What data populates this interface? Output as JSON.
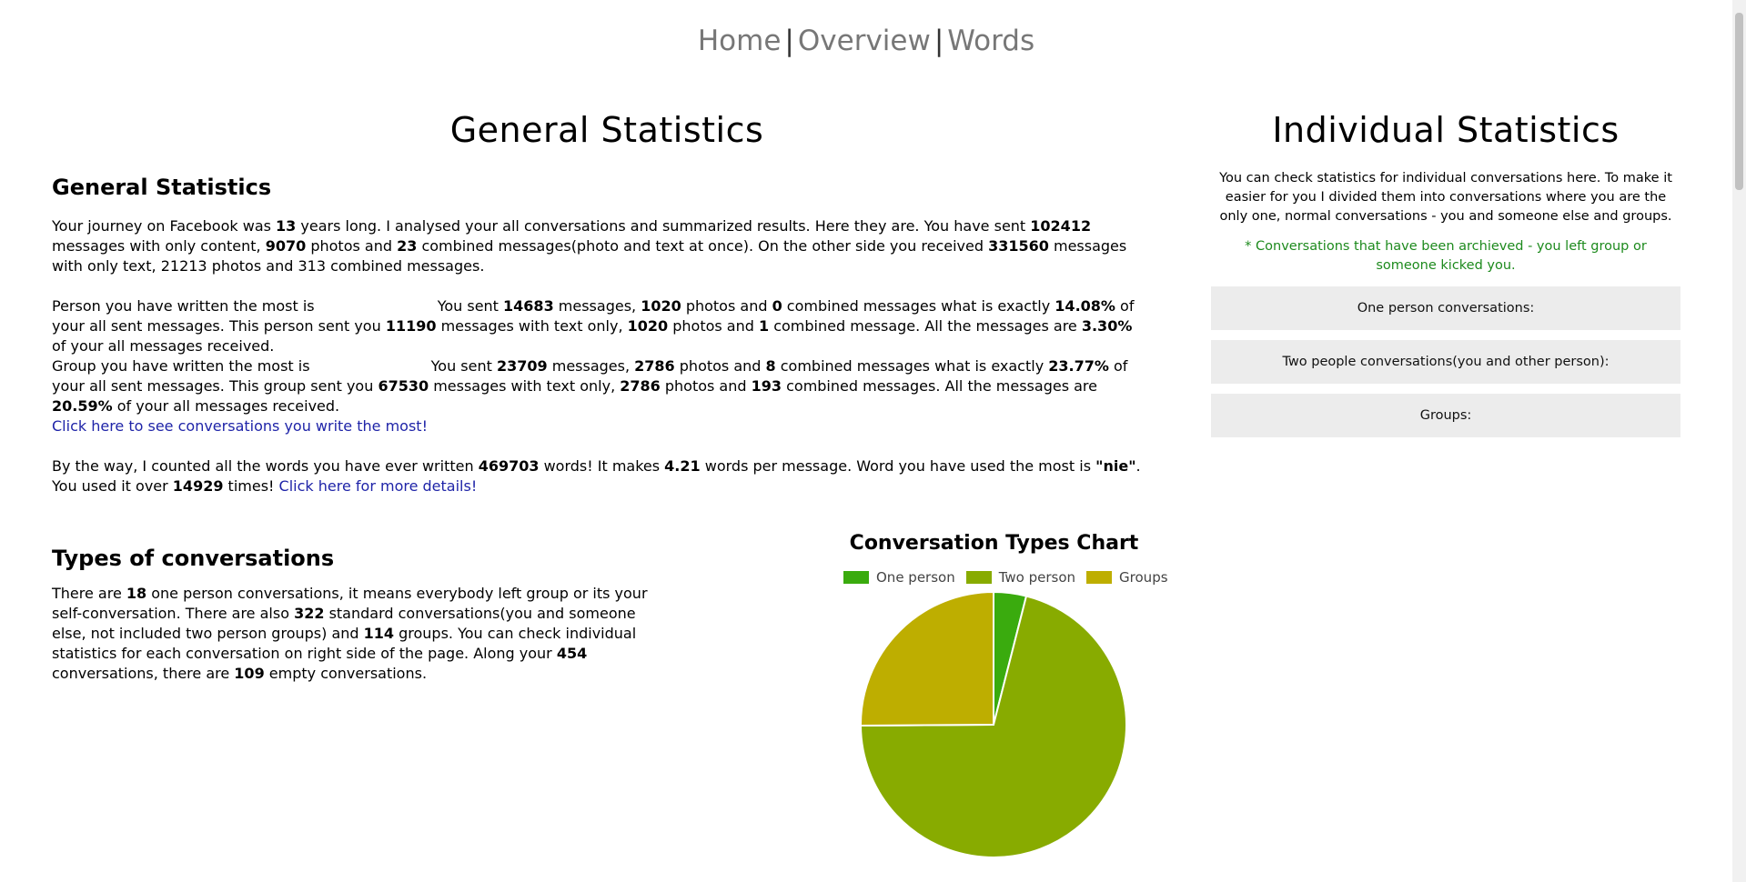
{
  "nav": {
    "home": "Home",
    "overview": "Overview",
    "words": "Words",
    "sep": "|"
  },
  "left": {
    "title": "General Statistics",
    "section1": {
      "heading": "General Statistics",
      "p1": [
        "Your journey on Facebook was ",
        "13",
        " years long. I analysed your all conversations and summarized results. Here they are. You have sent ",
        "102412",
        " messages with only content, ",
        "9070",
        " photos and ",
        "23",
        " combined messages(photo and text at once). On the other side you received ",
        "331560",
        " messages with only text, 21213 photos and 313 combined messages."
      ],
      "p2a": [
        "Person you have written the most is ",
        "You sent ",
        "14683",
        " messages, ",
        "1020",
        " photos and ",
        "0",
        " combined messages what is exactly ",
        "14.08%",
        " of your all sent messages. This person sent you ",
        "11190",
        " messages with text only, ",
        "1020",
        " photos and ",
        "1",
        " combined message. All the messages are ",
        "3.30%",
        " of your all messages received."
      ],
      "p2b": [
        "Group you have written the most is ",
        "You sent ",
        "23709",
        " messages, ",
        "2786",
        " photos and ",
        "8",
        " combined messages what is exactly ",
        "23.77%",
        " of your all sent messages. This group sent you ",
        "67530",
        " messages with text only, ",
        "2786",
        " photos and ",
        "193",
        " combined messages. All the messages are ",
        "20.59%",
        " of your all messages received."
      ],
      "link1": "Click here to see conversations you write the most!",
      "p3": [
        "By the way, I counted all the words you have ever written ",
        "469703",
        " words! It makes ",
        "4.21",
        " words per message. Word you have used the most is ",
        "\"nie\"",
        ". You used it over ",
        "14929",
        " times! "
      ],
      "link2": "Click here for more details!"
    },
    "section2": {
      "heading": "Types of conversations",
      "p": [
        "There are ",
        "18",
        " one person conversations, it means everybody left group or its your self-conversation. There are also ",
        "322",
        " standard conversations(you and someone else, not included two person groups) and ",
        "114",
        " groups. You can check individual statistics for each conversation on right side of the page. Along your ",
        "454",
        " conversations, there are ",
        "109",
        " empty conversations."
      ]
    }
  },
  "right": {
    "title": "Individual Statistics",
    "desc": "You can check statistics for individual conversations here. To make it easier for you I divided them into conversations where you are the only one, normal conversations - you and someone else and groups.",
    "note": "* Conversations that have been archieved - you left group or someone kicked you.",
    "accordions": [
      "One person conversations:",
      "Two people conversations(you and other person):",
      "Groups:"
    ]
  },
  "chart_data": {
    "type": "pie",
    "title": "Conversation Types Chart",
    "categories": [
      "One person",
      "Two person",
      "Groups"
    ],
    "values": [
      18,
      322,
      114
    ],
    "colors": [
      "#3aab0e",
      "#88ab00",
      "#beae00"
    ],
    "legend": "top"
  }
}
